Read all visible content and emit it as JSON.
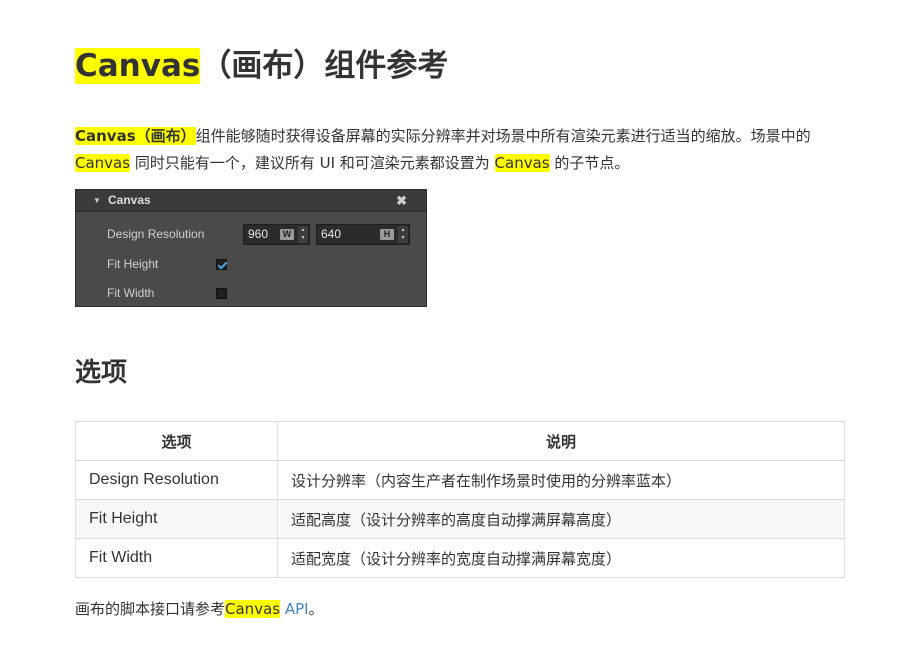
{
  "page": {
    "title_highlight": "Canvas",
    "title_rest": "（画布）组件参考"
  },
  "intro": {
    "p1_bold": "Canvas（画布）",
    "p1_text": "组件能够随时获得设备屏幕的实际分辨率并对场景中所有渲染元素进行适当的缩放。场景中的 ",
    "p1_hl": "Canvas",
    "p2_text": " 同时只能有一个，建议所有 UI 和可渲染元素都设置为 ",
    "p2_hl": "Canvas",
    "p3_text": " 的子节点。"
  },
  "panel": {
    "title": "Canvas",
    "close_glyph": "✖",
    "caret_glyph": "▼",
    "design_resolution_label": "Design Resolution",
    "width_value": "960",
    "width_unit": "W",
    "height_value": "640",
    "height_unit": "H",
    "fit_height_label": "Fit Height",
    "fit_height_checked": true,
    "fit_width_label": "Fit Width",
    "fit_width_checked": false
  },
  "section": {
    "title": "选项"
  },
  "table": {
    "headers": [
      "选项",
      "说明"
    ],
    "rows": [
      [
        "Design Resolution",
        "设计分辨率（内容生产者在制作场景时使用的分辨率蓝本）"
      ],
      [
        "Fit Height",
        "适配高度（设计分辨率的高度自动撑满屏幕高度）"
      ],
      [
        "Fit Width",
        "适配宽度（设计分辨率的宽度自动撑满屏幕宽度）"
      ]
    ]
  },
  "footer": {
    "text": "画布的脚本接口请参考",
    "hl": "Canvas",
    "link": "API",
    "end": "。"
  },
  "colors": {
    "highlight": "#ffff00",
    "link": "#4183c4",
    "panel_bg": "#4a4a4a"
  }
}
